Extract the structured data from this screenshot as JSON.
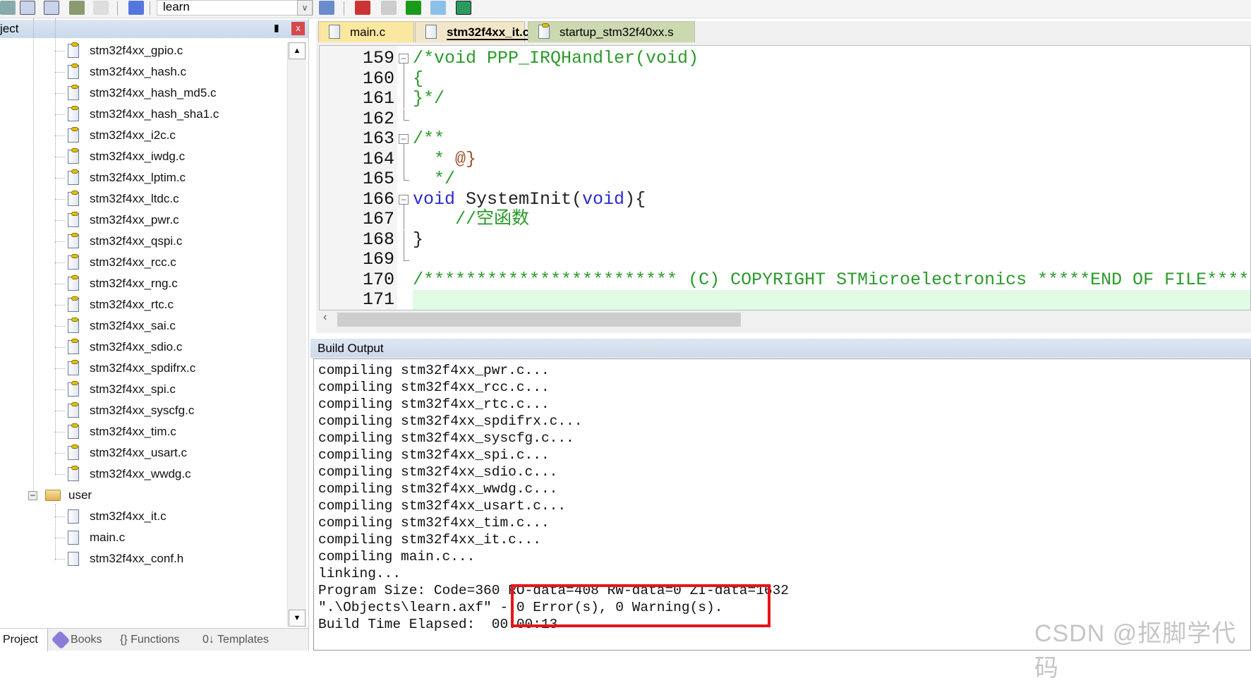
{
  "toolbar": {
    "target": "learn"
  },
  "project_panel": {
    "title": "Project",
    "title_visible": "ject",
    "pin_icon": "pin-icon",
    "close_label": "x",
    "files": [
      "stm32f4xx_gpio.c",
      "stm32f4xx_hash.c",
      "stm32f4xx_hash_md5.c",
      "stm32f4xx_hash_sha1.c",
      "stm32f4xx_i2c.c",
      "stm32f4xx_iwdg.c",
      "stm32f4xx_lptim.c",
      "stm32f4xx_ltdc.c",
      "stm32f4xx_pwr.c",
      "stm32f4xx_qspi.c",
      "stm32f4xx_rcc.c",
      "stm32f4xx_rng.c",
      "stm32f4xx_rtc.c",
      "stm32f4xx_sai.c",
      "stm32f4xx_sdio.c",
      "stm32f4xx_spdifrx.c",
      "stm32f4xx_spi.c",
      "stm32f4xx_syscfg.c",
      "stm32f4xx_tim.c",
      "stm32f4xx_usart.c",
      "stm32f4xx_wwdg.c"
    ],
    "user_group": {
      "label": "user",
      "files": [
        "stm32f4xx_it.c",
        "main.c",
        "stm32f4xx_conf.h"
      ]
    },
    "bottom_tabs": [
      "Project",
      "Books",
      "{} Functions",
      "0↓ Templates"
    ]
  },
  "editor": {
    "tabs": [
      {
        "label": "main.c",
        "active": false
      },
      {
        "label": "stm32f4xx_it.c",
        "active": true
      },
      {
        "label": "startup_stm32f40xx.s",
        "active": false
      }
    ],
    "lines": [
      {
        "n": "159",
        "fold": "box",
        "tokens": [
          [
            "/*void PPP_IRQHandler(void)",
            "c"
          ]
        ]
      },
      {
        "n": "160",
        "fold": "line",
        "tokens": [
          [
            "{",
            "c"
          ]
        ]
      },
      {
        "n": "161",
        "fold": "line",
        "tokens": [
          [
            "}*/",
            "c"
          ]
        ]
      },
      {
        "n": "162",
        "fold": "end",
        "tokens": []
      },
      {
        "n": "163",
        "fold": "box",
        "tokens": [
          [
            "/**",
            "c"
          ]
        ]
      },
      {
        "n": "164",
        "fold": "line",
        "tokens": [
          [
            "  * ",
            "c"
          ],
          [
            "@}",
            "at"
          ]
        ]
      },
      {
        "n": "165",
        "fold": "end",
        "tokens": [
          [
            "  */",
            "c"
          ]
        ]
      },
      {
        "n": "166",
        "fold": "box",
        "tokens": [
          [
            "void",
            "kw"
          ],
          [
            " SystemInit(",
            "n"
          ],
          [
            "void",
            "kw"
          ],
          [
            "){",
            "n"
          ]
        ]
      },
      {
        "n": "167",
        "fold": "line",
        "tokens": [
          [
            "    //空函数",
            "c"
          ]
        ]
      },
      {
        "n": "168",
        "fold": "line",
        "tokens": [
          [
            "}",
            "n"
          ]
        ]
      },
      {
        "n": "169",
        "fold": "end",
        "tokens": []
      },
      {
        "n": "170",
        "fold": "",
        "tokens": [
          [
            "/************************ (C) COPYRIGHT STMicroelectronics *****END OF FILE****/",
            "c"
          ]
        ]
      },
      {
        "n": "171",
        "fold": "",
        "tokens": [],
        "highlight": true
      }
    ]
  },
  "build_output": {
    "title": "Build Output",
    "lines": [
      "compiling stm32f4xx_pwr.c...",
      "compiling stm32f4xx_rcc.c...",
      "compiling stm32f4xx_rtc.c...",
      "compiling stm32f4xx_spdifrx.c...",
      "compiling stm32f4xx_syscfg.c...",
      "compiling stm32f4xx_spi.c...",
      "compiling stm32f4xx_sdio.c...",
      "compiling stm32f4xx_wwdg.c...",
      "compiling stm32f4xx_usart.c...",
      "compiling stm32f4xx_tim.c...",
      "compiling stm32f4xx_it.c...",
      "compiling main.c...",
      "linking...",
      "Program Size: Code=360 RO-data=408 RW-data=0 ZI-data=1632",
      "\".\\Objects\\learn.axf\" - 0 Error(s), 0 Warning(s).",
      "Build Time Elapsed:  00:00:13"
    ],
    "highlight_color": "#e8141a"
  },
  "watermark": "CSDN @抠脚学代码"
}
